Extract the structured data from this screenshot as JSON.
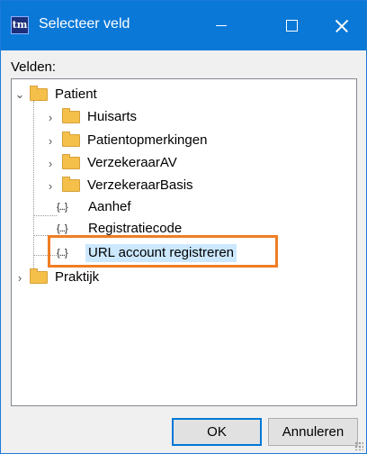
{
  "window": {
    "title": "Selecteer veld",
    "app_icon_text": "tm"
  },
  "fields_label": "Velden:",
  "tree": {
    "root": {
      "label": "Patient",
      "expanded": true
    },
    "folders": [
      {
        "label": "Huisarts",
        "expanded": false
      },
      {
        "label": "Patientopmerkingen",
        "expanded": false
      },
      {
        "label": "VerzekeraarAV",
        "expanded": false
      },
      {
        "label": "VerzekeraarBasis",
        "expanded": false
      }
    ],
    "fields": [
      {
        "label": "Aanhef",
        "icon": "{...}"
      },
      {
        "label": "Registratiecode",
        "icon": "{...}"
      },
      {
        "label": "URL account registreren",
        "icon": "{...}",
        "selected": true
      }
    ],
    "root2": {
      "label": "Praktijk",
      "expanded": false
    }
  },
  "buttons": {
    "ok": "OK",
    "cancel": "Annuleren"
  },
  "colors": {
    "titlebar": "#0a78d7",
    "highlight": "#ef7d23",
    "selection": "#cce8ff"
  }
}
